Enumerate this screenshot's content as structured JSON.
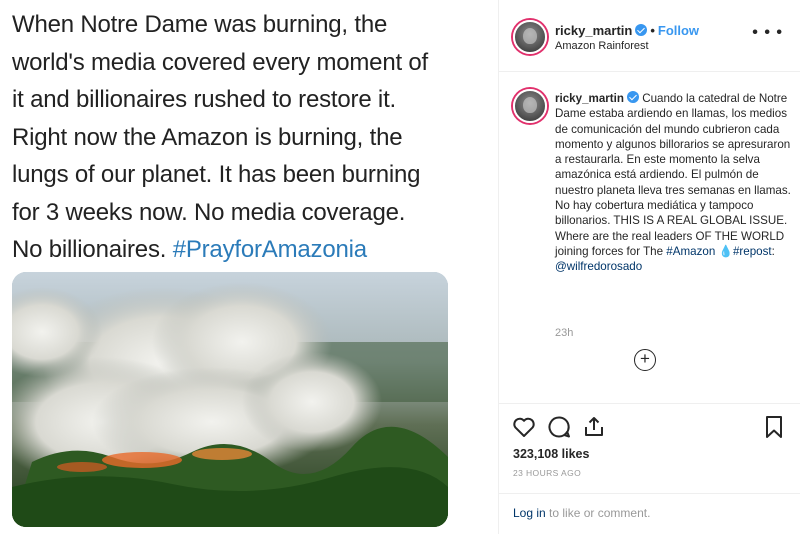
{
  "post_image": {
    "tweet_lines": [
      "When Notre Dame was burning, the",
      "world's media covered every moment of",
      "it and billionaires rushed to restore it.",
      "Right now the Amazon is burning, the",
      "lungs of our planet. It has been burning",
      "for 3 weeks now. No media coverage.",
      "No billionaires."
    ],
    "hashtag": "#PrayforAmazonia"
  },
  "header": {
    "username": "ricky_martin",
    "separator": "•",
    "follow_label": "Follow",
    "location": "Amazon Rainforest",
    "more_icon": "more-options-icon"
  },
  "caption": {
    "username": "ricky_martin",
    "text_main": "Cuando la catedral de Notre Dame estaba ardiendo en llamas, los medios de comunicación del mundo cubrieron cada momento y algunos billorarios se apresuraron a restaurarla. En este momento la selva amazónica está ardiendo. El pulmón de nuestro planeta lleva tres semanas en llamas. No hay cobertura mediática y tampoco billonarios. THIS IS A REAL GLOBAL ISSUE. Where are the real leaders OF THE WORLD joining forces for The",
    "hashtag_amazon": "#Amazon",
    "emoji": "💧",
    "hashtag_repost": "#repost",
    "colon": ":",
    "mention": "@wilfredorosado",
    "time": "23h",
    "load_more": "+"
  },
  "actions": {
    "likes": "323,108 likes",
    "date": "23 HOURS AGO",
    "login_link": "Log in",
    "login_rest": " to like or comment."
  },
  "colors": {
    "link_blue": "#3897f0",
    "dark_link": "#003569",
    "hashtag_twitter": "#2b7bb9"
  }
}
